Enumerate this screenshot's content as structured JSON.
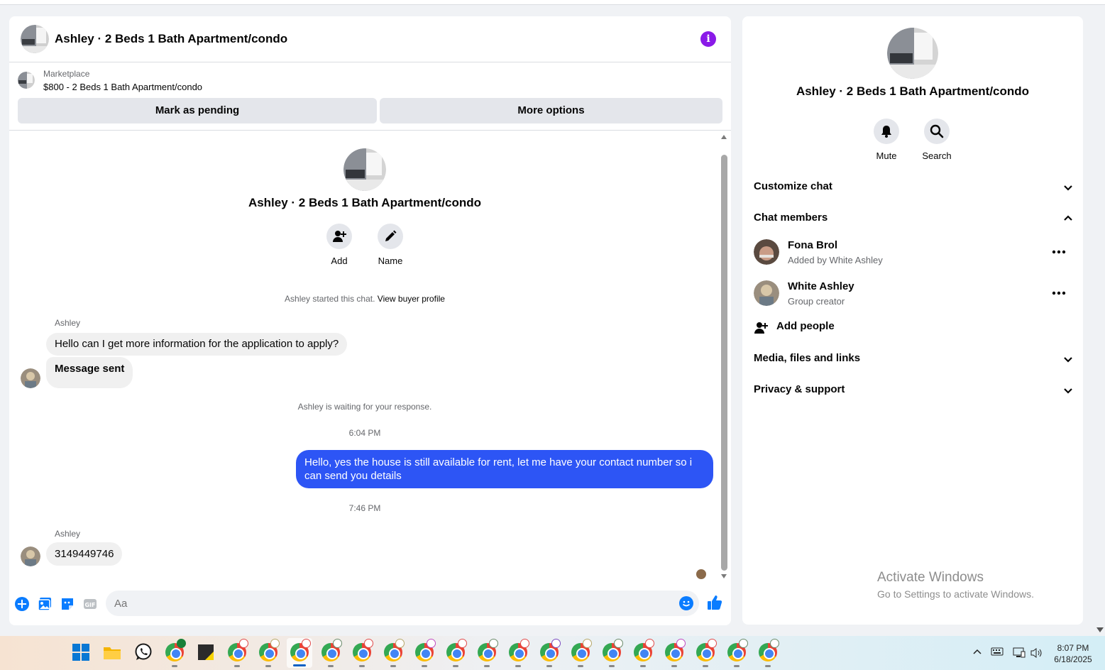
{
  "chat": {
    "header_title": "Ashley · 2 Beds 1 Bath Apartment/condo",
    "marketplace_label": "Marketplace",
    "listing_title": "$800 - 2 Beds 1 Bath Apartment/condo",
    "mark_pending_label": "Mark as pending",
    "more_options_label": "More options",
    "center_title": "Ashley · 2 Beds 1 Bath Apartment/condo",
    "add_label": "Add",
    "name_label": "Name",
    "started_text": "Ashley started this chat.",
    "view_buyer_profile": "View buyer profile",
    "messages": [
      {
        "sender": "Ashley",
        "text": "Hello can I get more information for the application to apply?"
      },
      {
        "text": "Message sent"
      },
      {
        "sender": "Ashley",
        "text": "3149449746"
      }
    ],
    "waiting_text": "Ashley is waiting for your response.",
    "time1": "6:04 PM",
    "outgoing_text": "Hello, yes the house is still available for rent, let me have your contact number so i can send you  details",
    "time2": "7:46 PM",
    "input_placeholder": "Aa"
  },
  "side": {
    "title": "Ashley · 2 Beds 1 Bath Apartment/condo",
    "mute_label": "Mute",
    "search_label": "Search",
    "customize_chat": "Customize chat",
    "chat_members": "Chat members",
    "members": [
      {
        "name": "Fona Brol",
        "sub": "Added by White Ashley"
      },
      {
        "name": "White Ashley",
        "sub": "Group creator"
      }
    ],
    "add_people": "Add people",
    "media_files": "Media, files and links",
    "privacy_support": "Privacy & support"
  },
  "watermark": {
    "line1": "Activate Windows",
    "line2": "Go to Settings to activate Windows."
  },
  "taskbar": {
    "time": "8:07 PM",
    "date": "6/18/2025"
  },
  "colors": {
    "accent_blue": "#2d55f5",
    "messenger_blue": "#0a7cff",
    "info_purple": "#8a1ae8"
  }
}
